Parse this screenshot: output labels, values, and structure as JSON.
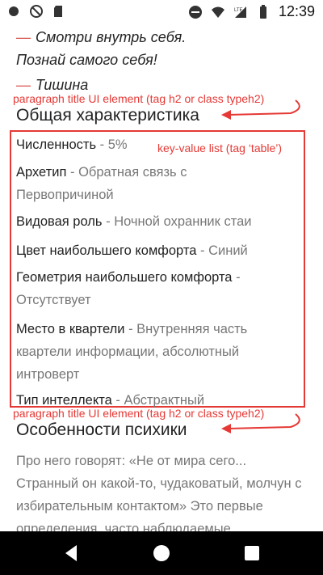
{
  "status_bar": {
    "time": "12:39",
    "network": "LTE"
  },
  "quotes": [
    {
      "dash": "—",
      "text": "Смотри внутрь себя."
    },
    {
      "dash": "",
      "text": "Познай самого себя!"
    },
    {
      "dash": "—",
      "text": "Тишина"
    }
  ],
  "annotations": {
    "title1": "paragraph title UI element (tag h2 or class typeh2)",
    "kv": "key-value list (tag ‘table’)",
    "title2": "paragraph title UI element (tag h2 or class typeh2)"
  },
  "section1": {
    "title": "Общая характеристика",
    "items": [
      {
        "key": "Численность",
        "value": " - 5%"
      },
      {
        "key": "Архетип",
        "value": " - Обратная связь с Первопричиной"
      },
      {
        "key": "Видовая роль",
        "value": " - Ночной охранник стаи"
      },
      {
        "key": "Цвет наибольшего комфорта",
        "value": " - Синий"
      },
      {
        "key": "Геометрия наибольшего комфорта",
        "value": " - Отсутствует"
      },
      {
        "key": "Место в квартели",
        "value": " - Внутренняя часть квартели информации, абсолютный интроверт"
      },
      {
        "key": "Тип интеллекта",
        "value": " - Абстрактный"
      }
    ]
  },
  "section2": {
    "title": "Особенности психики",
    "paragraph": "Про него говорят: «Не от мира сего... Странный он какой-то, чудаковатый, молчун с избирательным контактом» Это первые определения, часто наблюдаемые"
  },
  "colors": {
    "annotation": "#e53935",
    "dash": "#d9534f",
    "value_text": "#777777"
  }
}
